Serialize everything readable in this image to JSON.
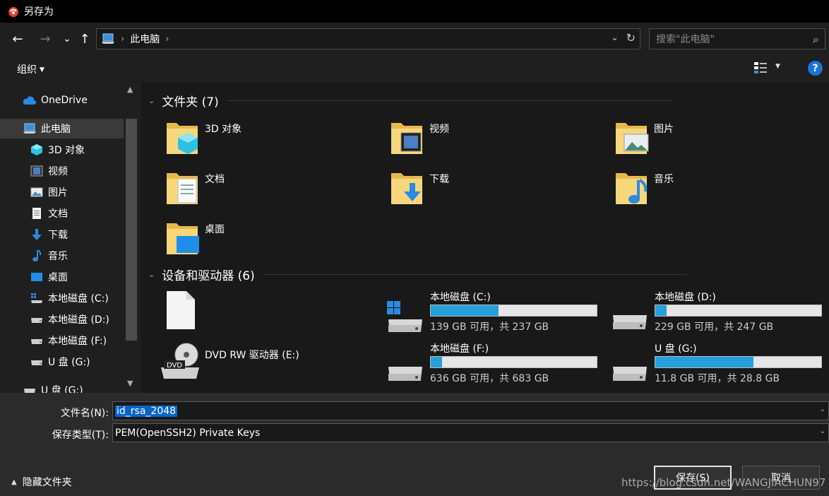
{
  "window": {
    "title": "另存为",
    "app_icon": "app-logo-icon"
  },
  "nav": {
    "back": "←",
    "forward": "→",
    "recent": "⌄",
    "up": "↑",
    "breadcrumb": "此电脑",
    "search_placeholder": "搜索\"此电脑\"",
    "search_icon": "⌕",
    "refresh": "↻"
  },
  "toolbar": {
    "organize": "组织",
    "help": "?"
  },
  "sidebar": {
    "items": [
      {
        "label": "OneDrive",
        "icon": "cloud-icon"
      },
      {
        "label": "此电脑",
        "icon": "pc-icon",
        "selected": true
      },
      {
        "label": "3D 对象",
        "icon": "cube-icon"
      },
      {
        "label": "视频",
        "icon": "video-icon"
      },
      {
        "label": "图片",
        "icon": "picture-icon"
      },
      {
        "label": "文档",
        "icon": "document-icon"
      },
      {
        "label": "下载",
        "icon": "download-icon"
      },
      {
        "label": "音乐",
        "icon": "music-icon"
      },
      {
        "label": "桌面",
        "icon": "desktop-icon"
      },
      {
        "label": "本地磁盘 (C:)",
        "icon": "windows-drive-icon"
      },
      {
        "label": "本地磁盘 (D:)",
        "icon": "drive-icon"
      },
      {
        "label": "本地磁盘 (F:)",
        "icon": "drive-icon"
      },
      {
        "label": "U 盘 (G:)",
        "icon": "usb-drive-icon"
      },
      {
        "label": "U 盘 (G:)",
        "icon": "usb-drive-icon"
      }
    ]
  },
  "main": {
    "folders_header": "文件夹 (7)",
    "folders": [
      {
        "label": "3D 对象",
        "icon": "cube-folder-icon"
      },
      {
        "label": "视频",
        "icon": "video-folder-icon"
      },
      {
        "label": "图片",
        "icon": "picture-folder-icon"
      },
      {
        "label": "文档",
        "icon": "document-folder-icon"
      },
      {
        "label": "下载",
        "icon": "download-folder-icon"
      },
      {
        "label": "音乐",
        "icon": "music-folder-icon"
      },
      {
        "label": "桌面",
        "icon": "desktop-folder-icon"
      }
    ],
    "drives_header": "设备和驱动器 (6)",
    "drives": [
      {
        "name": "本地磁盘 (C:)",
        "info": "139 GB 可用，共 237 GB",
        "used_fraction": 0.41,
        "icon": "windows-drive-icon"
      },
      {
        "name": "本地磁盘 (D:)",
        "info": "229 GB 可用，共 247 GB",
        "used_fraction": 0.07,
        "icon": "drive-icon"
      },
      {
        "name": "本地磁盘 (F:)",
        "info": "636 GB 可用，共 683 GB",
        "used_fraction": 0.07,
        "icon": "drive-icon"
      },
      {
        "name": "U 盘 (G:)",
        "info": "11.8 GB 可用，共 28.8 GB",
        "used_fraction": 0.59,
        "icon": "usb-drive-icon"
      }
    ],
    "dvd_drive": "DVD RW 驱动器 (E:)",
    "dvd_badge": "DVD"
  },
  "form": {
    "filename_label": "文件名(N):",
    "filename_value": "id_rsa_2048",
    "type_label": "保存类型(T):",
    "type_value": "PEM(OpenSSH2) Private Keys",
    "hide_folders": "隐藏文件夹",
    "save": "保存(S)",
    "cancel": "取消"
  },
  "watermark": "https://blog.csdn.net/WANGJIACHUN97",
  "colors": {
    "accent": "#26a0da",
    "selection": "#0a64c8",
    "help": "#1a73d9",
    "folder": "#f4c95d"
  }
}
